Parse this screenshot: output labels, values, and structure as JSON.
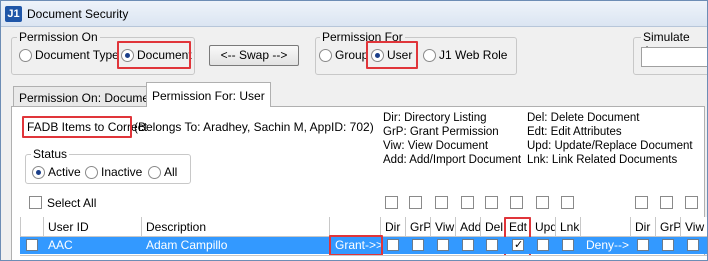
{
  "window": {
    "title": "Document Security",
    "app_icon": "J1"
  },
  "permission_on": {
    "label": "Permission On",
    "options": [
      "Document Type",
      "Document"
    ],
    "selected": "Document"
  },
  "swap_button": "<-- Swap -->",
  "permission_for": {
    "label": "Permission For",
    "options": [
      "Group",
      "User",
      "J1 Web Role"
    ],
    "selected": "User"
  },
  "simulate": {
    "label": "Simulate As...",
    "value": ""
  },
  "tabs": [
    "Permission On: Document",
    "Permission For: User"
  ],
  "active_tab": "Permission For: User",
  "entity": {
    "name": "FADB Items to Correct",
    "info": "(Belongs To: Aradhey, Sachin M, AppID: 702)"
  },
  "legend_left": [
    "Dir:  Directory Listing",
    "GrP:  Grant Permission",
    "Viw:  View Document",
    "Add:  Add/Import Document"
  ],
  "legend_right": [
    "Del:  Delete Document",
    "Edt:  Edit Attributes",
    "Upd:  Update/Replace Document",
    "Lnk:  Link Related Documents"
  ],
  "status": {
    "label": "Status",
    "options": [
      "Active",
      "Inactive",
      "All"
    ],
    "selected": "Active"
  },
  "select_all": "Select All",
  "grid": {
    "headers": [
      "User ID",
      "Description",
      "",
      "Dir",
      "GrP",
      "Viw",
      "Add",
      "Del",
      "Edt",
      "Upd",
      "Lnk",
      "",
      "Dir",
      "GrP",
      "Viw"
    ],
    "rows": [
      {
        "user_id": "AAC",
        "description": "Adam Campillo",
        "grant": "Grant->>",
        "deny": "Deny-->",
        "edt_checked": true
      }
    ]
  },
  "colors": {
    "selection": "#3399ff",
    "highlight_box": "#e0353a",
    "title_bar": "#dbe5f2"
  }
}
